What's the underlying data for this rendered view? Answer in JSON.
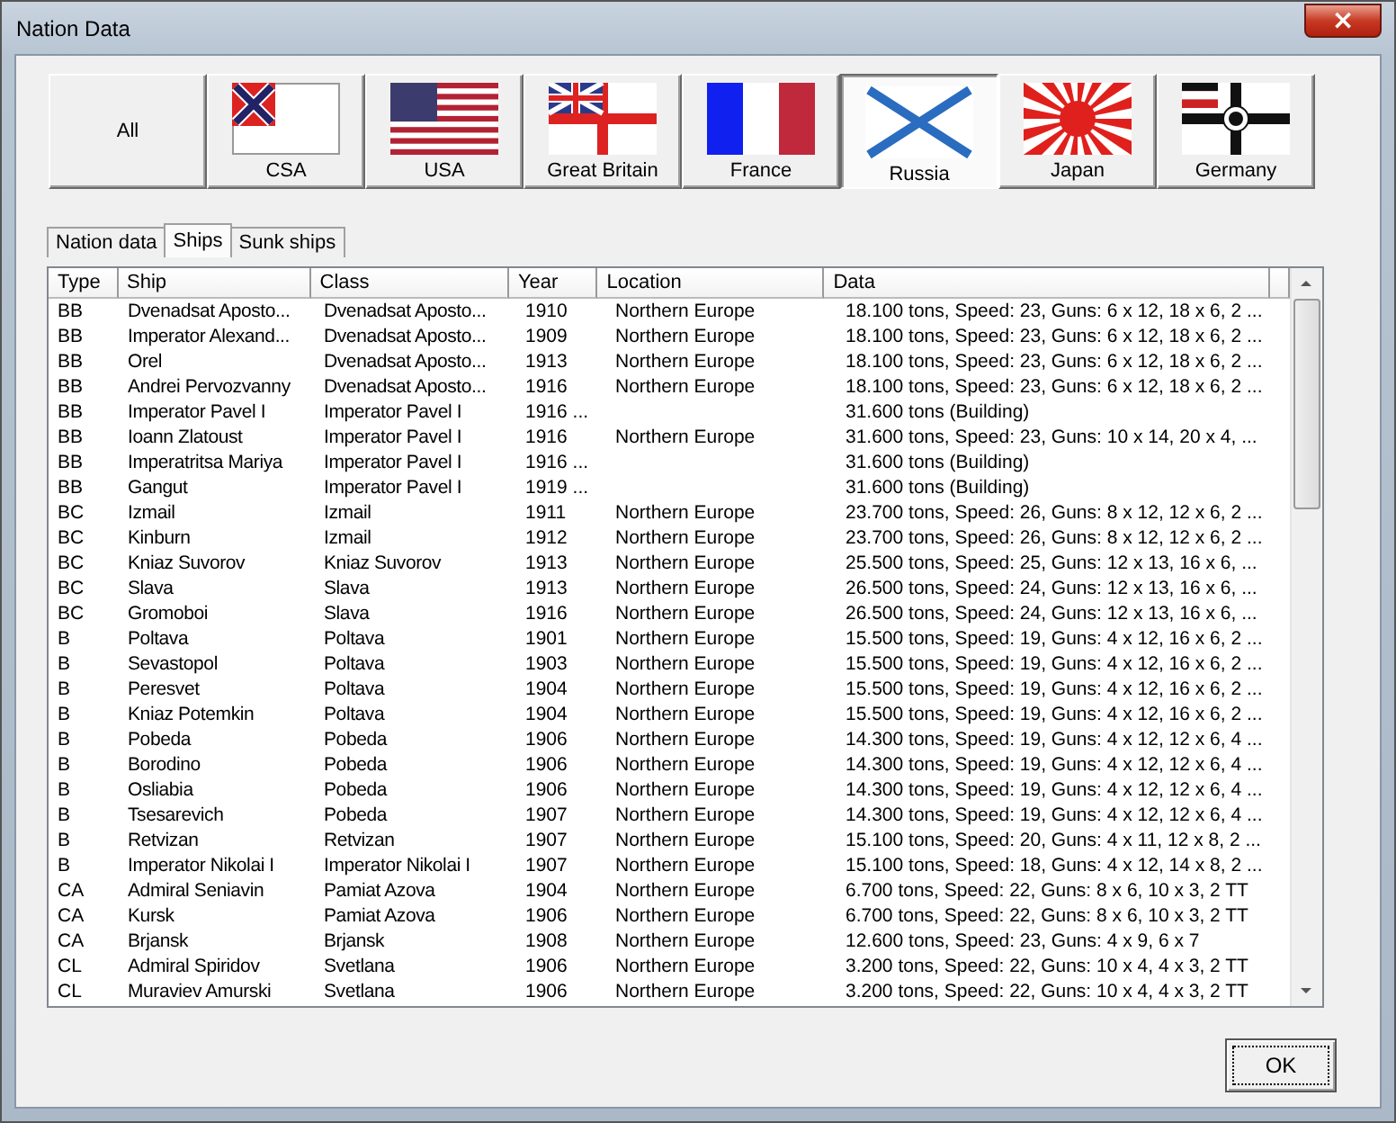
{
  "window": {
    "title": "Nation Data",
    "close": "×"
  },
  "nations": [
    {
      "label": "All",
      "kind": "none",
      "selected": false
    },
    {
      "label": "CSA",
      "kind": "csa",
      "selected": false
    },
    {
      "label": "USA",
      "kind": "usa",
      "selected": false
    },
    {
      "label": "Great Britain",
      "kind": "uk",
      "selected": false
    },
    {
      "label": "France",
      "kind": "france",
      "selected": false
    },
    {
      "label": "Russia",
      "kind": "russia",
      "selected": true
    },
    {
      "label": "Japan",
      "kind": "japan",
      "selected": false
    },
    {
      "label": "Germany",
      "kind": "germany",
      "selected": false
    }
  ],
  "tabs": [
    {
      "label": "Nation data",
      "selected": false
    },
    {
      "label": "Ships",
      "selected": true
    },
    {
      "label": "Sunk ships",
      "selected": false
    }
  ],
  "table": {
    "columns": [
      "Type",
      "Ship",
      "Class",
      "Year",
      "Location",
      "Data"
    ],
    "rows": [
      [
        "BB",
        "Dvenadsat Aposto...",
        "Dvenadsat Aposto...",
        "1910",
        "Northern Europe",
        "18.100 tons, Speed: 23, Guns: 6 x 12, 18 x 6, 2 ..."
      ],
      [
        "BB",
        "Imperator Alexand...",
        "Dvenadsat Aposto...",
        "1909",
        "Northern Europe",
        "18.100 tons, Speed: 23, Guns: 6 x 12, 18 x 6, 2 ..."
      ],
      [
        "BB",
        "Orel",
        "Dvenadsat Aposto...",
        "1913",
        "Northern Europe",
        "18.100 tons, Speed: 23, Guns: 6 x 12, 18 x 6, 2 ..."
      ],
      [
        "BB",
        "Andrei Pervozvanny",
        "Dvenadsat Aposto...",
        "1916",
        "Northern Europe",
        "18.100 tons, Speed: 23, Guns: 6 x 12, 18 x 6, 2 ..."
      ],
      [
        "BB",
        "Imperator Pavel I",
        "Imperator Pavel I",
        "1916 ...",
        "",
        "31.600 tons (Building)"
      ],
      [
        "BB",
        "Ioann Zlatoust",
        "Imperator Pavel I",
        "1916",
        "Northern Europe",
        "31.600 tons, Speed: 23, Guns: 10 x 14, 20 x 4, ..."
      ],
      [
        "BB",
        "Imperatritsa Mariya",
        "Imperator Pavel I",
        "1916 ...",
        "",
        "31.600 tons (Building)"
      ],
      [
        "BB",
        "Gangut",
        "Imperator Pavel I",
        "1919 ...",
        "",
        "31.600 tons (Building)"
      ],
      [
        "BC",
        "Izmail",
        "Izmail",
        "1911",
        "Northern Europe",
        "23.700 tons, Speed: 26, Guns: 8 x 12, 12 x 6, 2 ..."
      ],
      [
        "BC",
        "Kinburn",
        "Izmail",
        "1912",
        "Northern Europe",
        "23.700 tons, Speed: 26, Guns: 8 x 12, 12 x 6, 2 ..."
      ],
      [
        "BC",
        "Kniaz Suvorov",
        "Kniaz Suvorov",
        "1913",
        "Northern Europe",
        "25.500 tons, Speed: 25, Guns: 12 x 13, 16 x 6, ..."
      ],
      [
        "BC",
        "Slava",
        "Slava",
        "1913",
        "Northern Europe",
        "26.500 tons, Speed: 24, Guns: 12 x 13, 16 x 6, ..."
      ],
      [
        "BC",
        "Gromoboi",
        "Slava",
        "1916",
        "Northern Europe",
        "26.500 tons, Speed: 24, Guns: 12 x 13, 16 x 6, ..."
      ],
      [
        "B",
        "Poltava",
        "Poltava",
        "1901",
        "Northern Europe",
        "15.500 tons, Speed: 19, Guns: 4 x 12, 16 x 6, 2 ..."
      ],
      [
        "B",
        "Sevastopol",
        "Poltava",
        "1903",
        "Northern Europe",
        "15.500 tons, Speed: 19, Guns: 4 x 12, 16 x 6, 2 ..."
      ],
      [
        "B",
        "Peresvet",
        "Poltava",
        "1904",
        "Northern Europe",
        "15.500 tons, Speed: 19, Guns: 4 x 12, 16 x 6, 2 ..."
      ],
      [
        "B",
        "Kniaz Potemkin",
        "Poltava",
        "1904",
        "Northern Europe",
        "15.500 tons, Speed: 19, Guns: 4 x 12, 16 x 6, 2 ..."
      ],
      [
        "B",
        "Pobeda",
        "Pobeda",
        "1906",
        "Northern Europe",
        "14.300 tons, Speed: 19, Guns: 4 x 12, 12 x 6, 4 ..."
      ],
      [
        "B",
        "Borodino",
        "Pobeda",
        "1906",
        "Northern Europe",
        "14.300 tons, Speed: 19, Guns: 4 x 12, 12 x 6, 4 ..."
      ],
      [
        "B",
        "Osliabia",
        "Pobeda",
        "1906",
        "Northern Europe",
        "14.300 tons, Speed: 19, Guns: 4 x 12, 12 x 6, 4 ..."
      ],
      [
        "B",
        "Tsesarevich",
        "Pobeda",
        "1907",
        "Northern Europe",
        "14.300 tons, Speed: 19, Guns: 4 x 12, 12 x 6, 4 ..."
      ],
      [
        "B",
        "Retvizan",
        "Retvizan",
        "1907",
        "Northern Europe",
        "15.100 tons, Speed: 20, Guns: 4 x 11, 12 x 8, 2 ..."
      ],
      [
        "B",
        "Imperator Nikolai I",
        "Imperator Nikolai I",
        "1907",
        "Northern Europe",
        "15.100 tons, Speed: 18, Guns: 4 x 12, 14 x 8, 2 ..."
      ],
      [
        "CA",
        "Admiral Seniavin",
        "Pamiat Azova",
        "1904",
        "Northern Europe",
        "6.700 tons, Speed: 22, Guns: 8 x 6, 10 x 3, 2 TT"
      ],
      [
        "CA",
        "Kursk",
        "Pamiat Azova",
        "1906",
        "Northern Europe",
        "6.700 tons, Speed: 22, Guns: 8 x 6, 10 x 3, 2 TT"
      ],
      [
        "CA",
        "Brjansk",
        "Brjansk",
        "1908",
        "Northern Europe",
        "12.600 tons, Speed: 23, Guns: 4 x 9, 6 x 7"
      ],
      [
        "CL",
        "Admiral Spiridov",
        "Svetlana",
        "1906",
        "Northern Europe",
        "3.200 tons, Speed: 22, Guns: 10 x 4, 4 x 3, 2 TT"
      ],
      [
        "CL",
        "Muraviev Amurski",
        "Svetlana",
        "1906",
        "Northern Europe",
        "3.200 tons, Speed: 22, Guns: 10 x 4, 4 x 3, 2 TT"
      ]
    ]
  },
  "ok_button": "OK"
}
